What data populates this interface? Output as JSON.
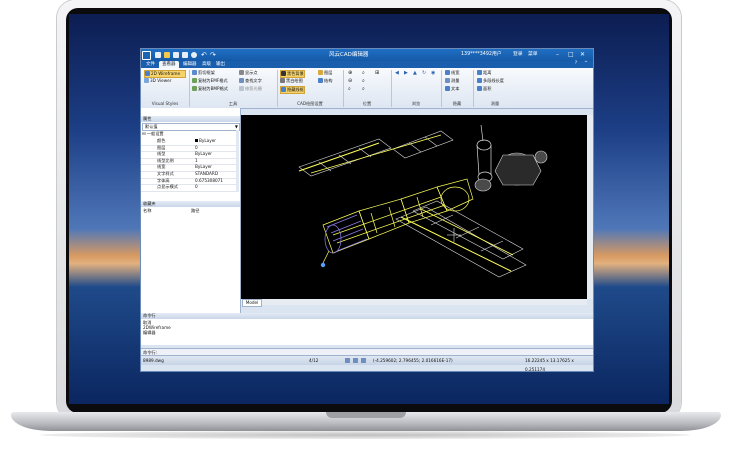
{
  "app": {
    "title": "风云CAD编辑器",
    "user": "139****3492用户",
    "login": "登录",
    "register": "菜单"
  },
  "tabs": [
    "文件",
    "查看器",
    "编辑器",
    "高级",
    "输出"
  ],
  "active_tab_index": 1,
  "ribbon": {
    "visual_styles": {
      "items": [
        "2D Wireframe",
        "3D Viewer"
      ],
      "group_label": "Visual Styles"
    },
    "tools": {
      "items": [
        "剪切框架",
        "复制为EMF格式",
        "复制为BMP格式",
        "显示点",
        "查找文字",
        "修剪光栅"
      ],
      "group_label": "工具"
    },
    "cad_settings": {
      "items": [
        "黑色背景",
        "黑白绘图",
        "隐藏线框",
        "图层",
        "结构"
      ],
      "group_label": "CAD绘图设置"
    },
    "position": {
      "group_label": "位置"
    },
    "browse": {
      "group_label": "浏览"
    },
    "hide": {
      "items": [
        "线宽",
        "测量",
        "文本"
      ],
      "group_label": "隐藏"
    },
    "measure": {
      "items": [
        "距离",
        "多段线长度",
        "面积"
      ],
      "group_label": "测量"
    }
  },
  "document_tab": "8989.dwg",
  "properties": {
    "header": "属性",
    "dropdown": "默认值",
    "section": "一般设置",
    "rows": [
      {
        "key": "颜色",
        "value": "ByLayer"
      },
      {
        "key": "图层",
        "value": "0"
      },
      {
        "key": "线型",
        "value": "ByLayer"
      },
      {
        "key": "线型比例",
        "value": "1"
      },
      {
        "key": "线宽",
        "value": "ByLayer"
      },
      {
        "key": "文字样式",
        "value": "STANDARD"
      },
      {
        "key": "字体高",
        "value": "0.675308071"
      },
      {
        "key": "点显示模式",
        "value": "0"
      }
    ]
  },
  "favorites": {
    "header": "收藏夹",
    "columns": [
      "名称",
      "路径"
    ]
  },
  "viewport": {
    "model_tab": "Model"
  },
  "command": {
    "header": "命令行",
    "lines": [
      "取消",
      "2DWireframe",
      "编辑器"
    ],
    "prompt": "命令行:"
  },
  "status": {
    "file": "8989.dwg",
    "page": "4/12",
    "coords_left": "(-4.259602; 2.796455; 2.016616E-17)",
    "coords_right": "16.22245 x 13.17625 x 0.251174"
  },
  "colors": {
    "wire_yellow": "#ffff5a",
    "wire_white": "#d9d9d9",
    "wire_purple": "#8a7ce8",
    "wire_blue": "#56a0ff"
  }
}
